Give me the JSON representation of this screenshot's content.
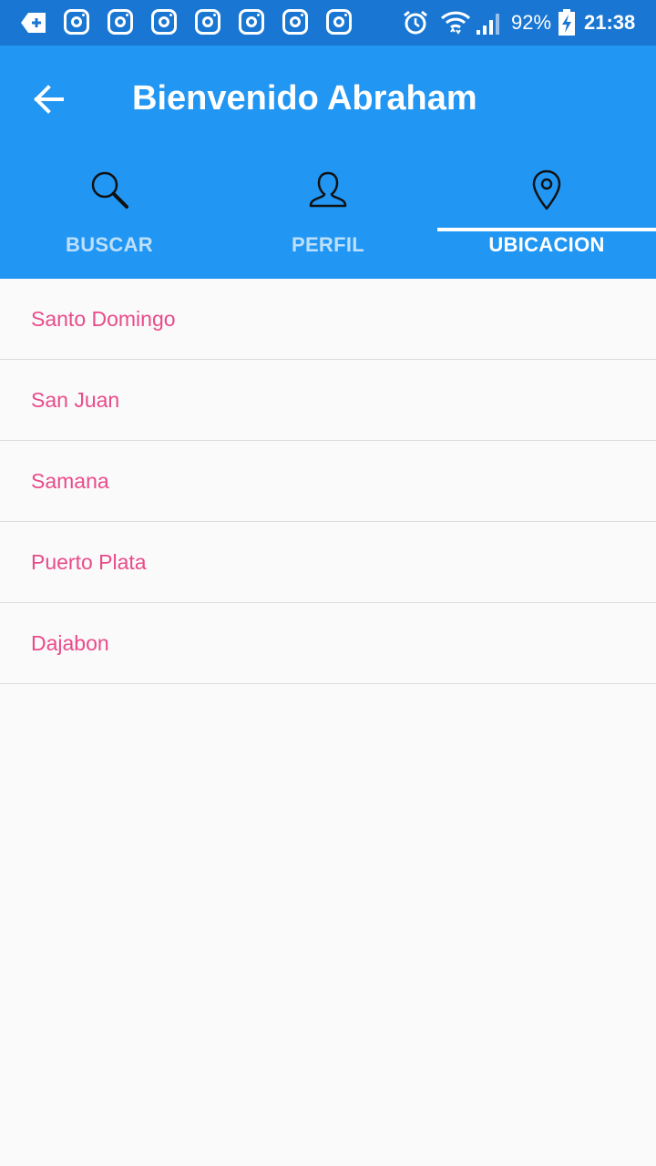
{
  "status_bar": {
    "battery": "92%",
    "time": "21:38",
    "notification_icons": [
      "close-tab-icon",
      "instagram-icon",
      "instagram-icon",
      "instagram-icon",
      "instagram-icon",
      "instagram-icon",
      "instagram-icon",
      "instagram-icon"
    ],
    "system_icons": [
      "alarm-icon",
      "wifi-icon",
      "signal-icon",
      "battery-charging-icon"
    ]
  },
  "app_bar": {
    "title": "Bienvenido Abraham",
    "back_icon": "arrow-left-icon"
  },
  "tabs": [
    {
      "label": "BUSCAR",
      "icon": "search-icon",
      "active": false
    },
    {
      "label": "PERFIL",
      "icon": "user-icon",
      "active": false
    },
    {
      "label": "UBICACION",
      "icon": "location-pin-icon",
      "active": true
    }
  ],
  "locations": [
    {
      "label": "Santo Domingo"
    },
    {
      "label": "San Juan"
    },
    {
      "label": "Samana"
    },
    {
      "label": "Puerto Plata"
    },
    {
      "label": "Dajabon"
    }
  ],
  "colors": {
    "status_bar": "#1976d2",
    "app_bar": "#2196f3",
    "list_text": "#e94b8a",
    "background": "#fafafa"
  }
}
